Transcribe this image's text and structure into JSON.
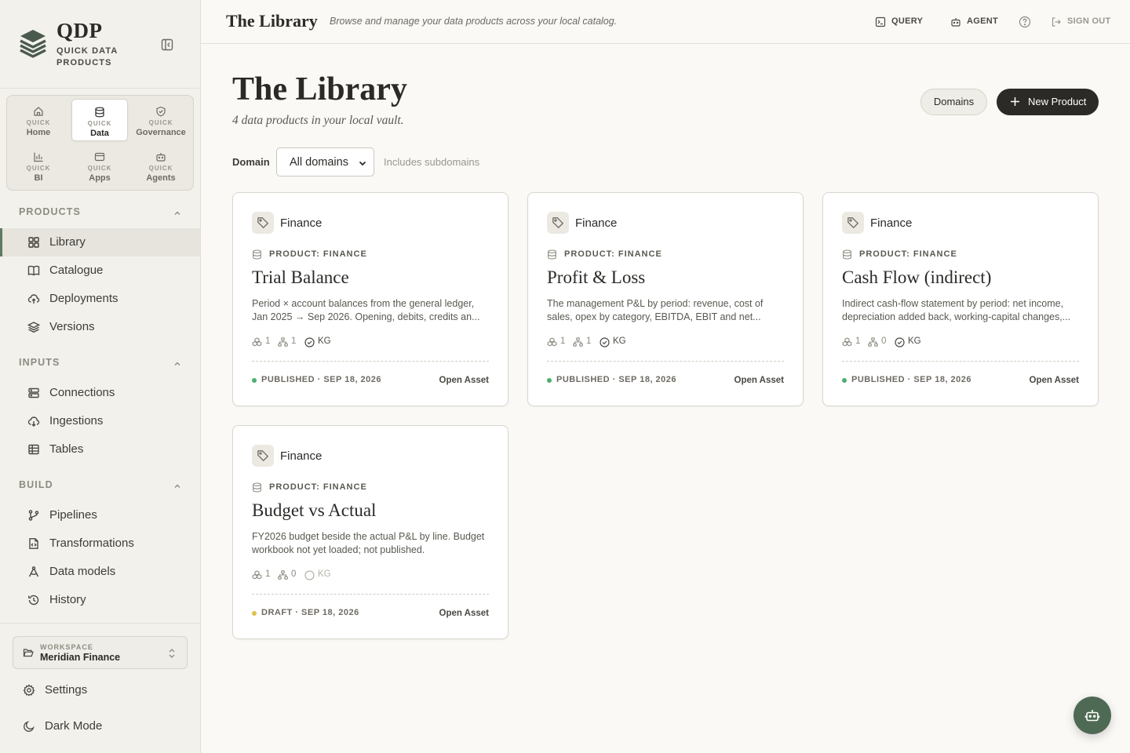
{
  "brand": {
    "name": "QDP",
    "subtitle": "QUICK DATA PRODUCTS"
  },
  "quick_nav": [
    {
      "top": "QUICK",
      "label": "Home",
      "icon": "home-icon"
    },
    {
      "top": "QUICK",
      "label": "Data",
      "icon": "database-icon",
      "active": true
    },
    {
      "top": "QUICK",
      "label": "Governance",
      "icon": "shield-icon"
    },
    {
      "top": "QUICK",
      "label": "BI",
      "icon": "chart-icon"
    },
    {
      "top": "QUICK",
      "label": "Apps",
      "icon": "window-icon"
    },
    {
      "top": "QUICK",
      "label": "Agents",
      "icon": "bot-icon"
    }
  ],
  "sections": {
    "products": {
      "title": "PRODUCTS",
      "items": [
        "Library",
        "Catalogue",
        "Deployments",
        "Versions"
      ]
    },
    "inputs": {
      "title": "INPUTS",
      "items": [
        "Connections",
        "Ingestions",
        "Tables"
      ]
    },
    "build": {
      "title": "BUILD",
      "items": [
        "Pipelines",
        "Transformations",
        "Data models",
        "History"
      ]
    }
  },
  "workspace": {
    "top": "WORKSPACE",
    "name": "Meridian Finance"
  },
  "bottom": {
    "settings": "Settings",
    "dark_mode": "Dark Mode"
  },
  "topbar": {
    "title": "The Library",
    "subtitle": "Browse and manage your data products across your local catalog.",
    "query": "QUERY",
    "agent": "AGENT",
    "sign_out": "SIGN OUT"
  },
  "main": {
    "title": "The Library",
    "subtitle": "4 data products in your local vault.",
    "domains_button": "Domains",
    "new_button": "New Product",
    "filter": {
      "label": "Domain",
      "value": "All domains",
      "note": "Includes subdomains"
    }
  },
  "colors": {
    "accent": "#5e7a62",
    "published": "#4caf6d",
    "draft": "#e0c24a",
    "dark": "#2b2a27"
  },
  "cards": [
    {
      "tag": "Finance",
      "type": "PRODUCT: FINANCE",
      "title": "Trial Balance",
      "desc": "Period × account balances from the general ledger, Jan 2025 → Sep 2026. Opening, debits, credits an...",
      "stat1": "1",
      "stat2": "1",
      "kg": "KG",
      "kg_on": true,
      "status": "PUBLISHED · SEP 18, 2026",
      "status_kind": "published",
      "open": "Open Asset"
    },
    {
      "tag": "Finance",
      "type": "PRODUCT: FINANCE",
      "title": "Profit & Loss",
      "desc": "The management P&L by period: revenue, cost of sales, opex by category, EBITDA, EBIT and net...",
      "stat1": "1",
      "stat2": "1",
      "kg": "KG",
      "kg_on": true,
      "status": "PUBLISHED · SEP 18, 2026",
      "status_kind": "published",
      "open": "Open Asset"
    },
    {
      "tag": "Finance",
      "type": "PRODUCT: FINANCE",
      "title": "Cash Flow (indirect)",
      "desc": "Indirect cash-flow statement by period: net income, depreciation added back, working-capital changes,...",
      "stat1": "1",
      "stat2": "0",
      "kg": "KG",
      "kg_on": true,
      "status": "PUBLISHED · SEP 18, 2026",
      "status_kind": "published",
      "open": "Open Asset"
    },
    {
      "tag": "Finance",
      "type": "PRODUCT: FINANCE",
      "title": "Budget vs Actual",
      "desc": "FY2026 budget beside the actual P&L by line. Budget workbook not yet loaded; not published.",
      "stat1": "1",
      "stat2": "0",
      "kg": "KG",
      "kg_on": false,
      "status": "DRAFT · SEP 18, 2026",
      "status_kind": "draft",
      "open": "Open Asset"
    }
  ]
}
